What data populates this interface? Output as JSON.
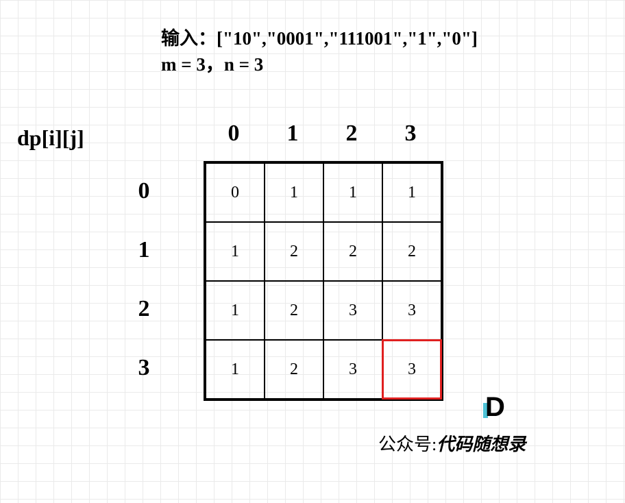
{
  "chart_data": {
    "type": "table",
    "title": "dp[i][j]",
    "col_headers": [
      "0",
      "1",
      "2",
      "3"
    ],
    "row_headers": [
      "0",
      "1",
      "2",
      "3"
    ],
    "cells": [
      [
        "0",
        "1",
        "1",
        "1"
      ],
      [
        "1",
        "2",
        "2",
        "2"
      ],
      [
        "1",
        "2",
        "3",
        "3"
      ],
      [
        "1",
        "2",
        "3",
        "3"
      ]
    ],
    "highlight": {
      "row": 3,
      "col": 3
    }
  },
  "input": {
    "line1": "输入：[\"10\",\"0001\",\"111001\",\"1\",\"0\"]",
    "line2": "m = 3，n = 3"
  },
  "dp_label": "dp[i][j]",
  "col_headers": {
    "c0": "0",
    "c1": "1",
    "c2": "2",
    "c3": "3"
  },
  "row_headers": {
    "r0": "0",
    "r1": "1",
    "r2": "2",
    "r3": "3"
  },
  "cells": {
    "r0c0": "0",
    "r0c1": "1",
    "r0c2": "1",
    "r0c3": "1",
    "r1c0": "1",
    "r1c1": "2",
    "r1c2": "2",
    "r1c3": "2",
    "r2c0": "1",
    "r2c1": "2",
    "r2c2": "3",
    "r2c3": "3",
    "r3c0": "1",
    "r3c1": "2",
    "r3c2": "3",
    "r3c3": "3"
  },
  "footer": {
    "label": "公众号:",
    "brand": "代码随想录"
  }
}
